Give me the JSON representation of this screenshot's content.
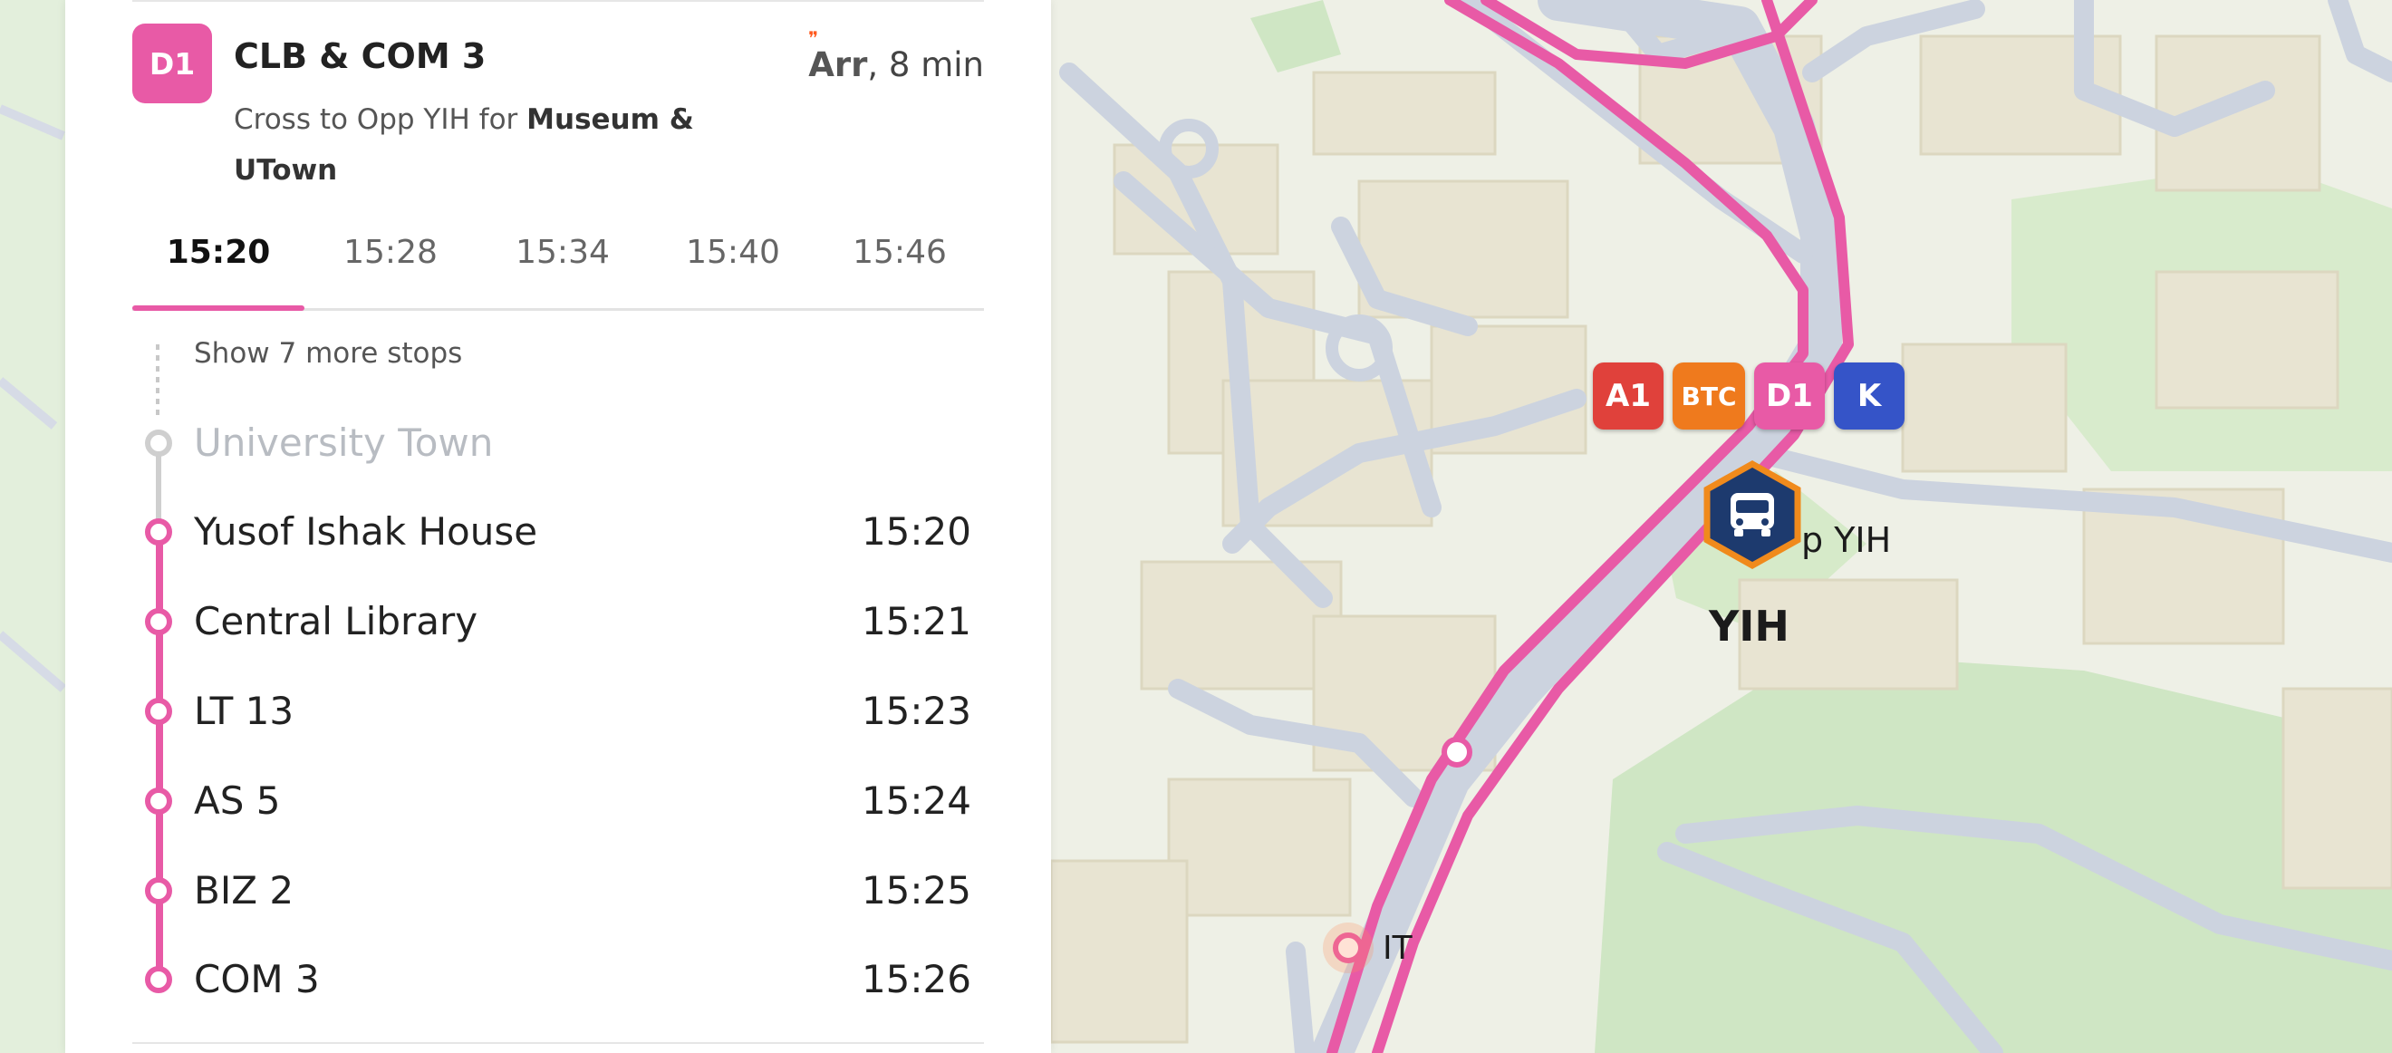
{
  "colors": {
    "route_pink": "#e85aa6",
    "a1_red": "#e0413b",
    "btc_orange": "#ef7a1d",
    "k_blue": "#3554c8",
    "stop_navy": "#1d3a6e",
    "stop_orange": "#f08a1c"
  },
  "route": {
    "code": "D1",
    "title": "CLB & COM 3",
    "subtitle_prefix": "Cross to Opp YIH for",
    "subtitle_bold": "Museum &",
    "subtitle_last": "UTown",
    "eta_label": "Arr",
    "eta_value": ", 8 min"
  },
  "tabs": [
    "15:20",
    "15:28",
    "15:34",
    "15:40",
    "15:46"
  ],
  "more_stops": "Show 7 more stops",
  "stops": [
    {
      "name": "University Town",
      "time": "",
      "past": true
    },
    {
      "name": "Yusof Ishak House",
      "time": "15:20"
    },
    {
      "name": "Central Library",
      "time": "15:21"
    },
    {
      "name": "LT 13",
      "time": "15:23"
    },
    {
      "name": "AS 5",
      "time": "15:24"
    },
    {
      "name": "BIZ 2",
      "time": "15:25"
    },
    {
      "name": "COM 3",
      "time": "15:26"
    }
  ],
  "map": {
    "chips": [
      "A1",
      "BTC",
      "D1",
      "K"
    ],
    "stop_label": "p YIH",
    "area_label": "YIH",
    "it_label": "IT",
    "icons": [
      "bus-stop-icon"
    ]
  }
}
